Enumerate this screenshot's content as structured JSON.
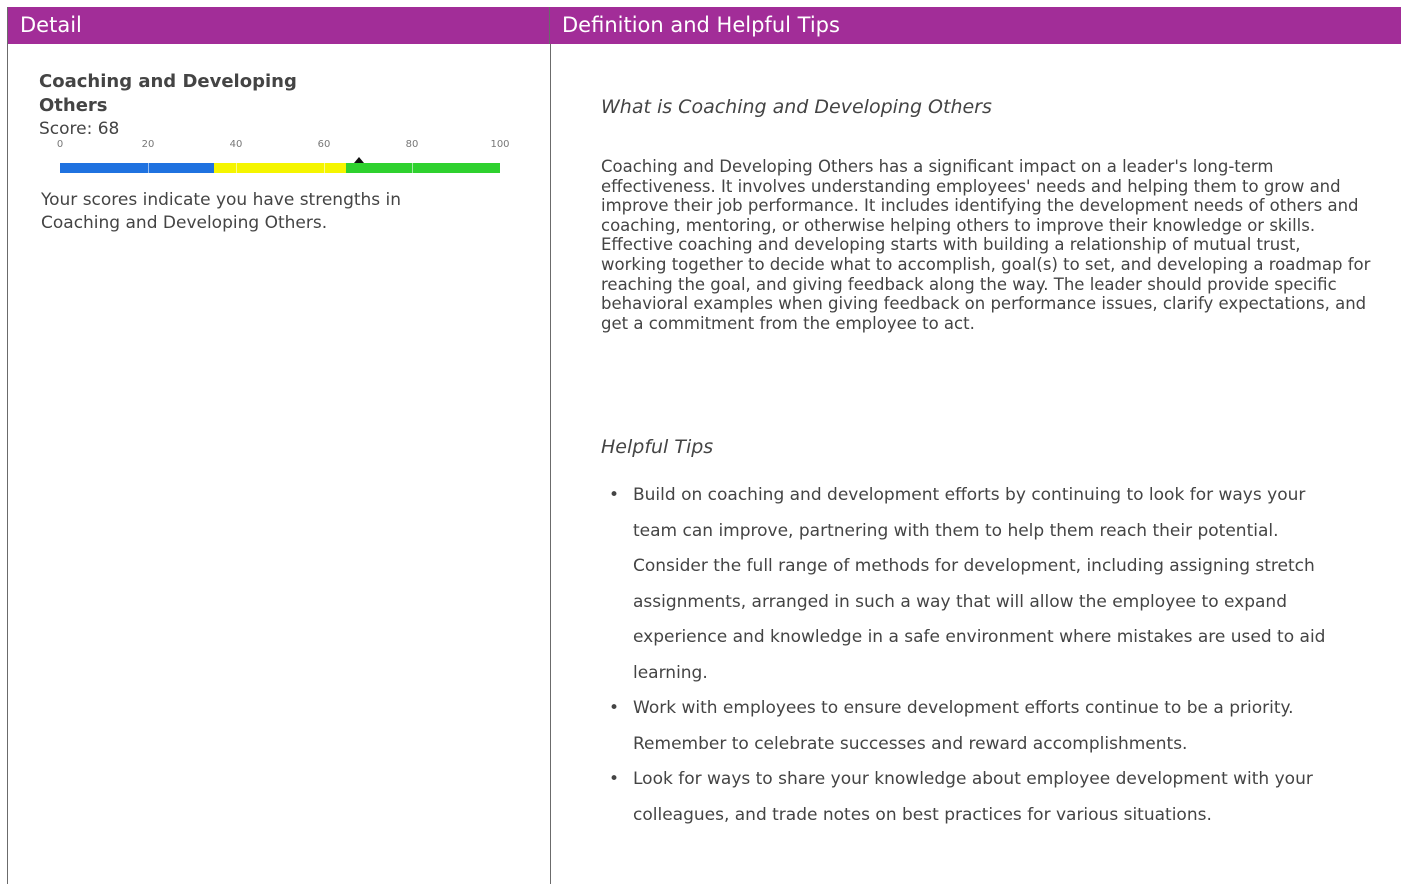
{
  "header": {
    "left_title": "Detail",
    "right_title": "Definition and Helpful Tips",
    "color": "#a22d98"
  },
  "detail": {
    "metric_title": "Coaching and Developing Others",
    "score_label": "Score: 68",
    "score_value": 68,
    "gauge": {
      "min": 0,
      "max": 100,
      "ticks": [
        "0",
        "20",
        "40",
        "60",
        "80",
        "100"
      ],
      "bands": [
        {
          "from": 0,
          "to": 35,
          "color": "#1f72e0"
        },
        {
          "from": 35,
          "to": 65,
          "color": "#f5f500"
        },
        {
          "from": 65,
          "to": 100,
          "color": "#2fd12f"
        }
      ]
    },
    "summary": "Your scores indicate you have strengths in Coaching and Developing Others."
  },
  "definition": {
    "heading": "What is Coaching and Developing Others",
    "text": "Coaching and Developing Others has a significant impact on a leader's long-term effectiveness. It involves understanding employees' needs and helping them to grow and improve their job performance. It includes identifying the development needs of others and coaching, mentoring, or otherwise helping others to improve their knowledge or skills. Effective coaching and developing starts with building a relationship of mutual trust, working together to decide what to accomplish, goal(s) to set, and developing a roadmap for reaching the goal, and giving feedback along the way. The leader should provide specific behavioral examples when giving feedback on performance issues, clarify expectations, and get a commitment from the employee to act."
  },
  "tips": {
    "heading": "Helpful Tips",
    "items": [
      "Build on coaching and development efforts by continuing to look for ways your team can improve, partnering with them to help them reach their potential. Consider the full range of methods for development, including assigning stretch assignments, arranged in such a way that will allow the employee to expand experience and knowledge in a safe environment where mistakes are used to aid learning.",
      "Work with employees to ensure development efforts continue to be a priority. Remember to celebrate successes and reward accomplishments.",
      "Look for ways to share your knowledge about employee development with your colleagues, and trade notes on best practices for various situations."
    ]
  }
}
